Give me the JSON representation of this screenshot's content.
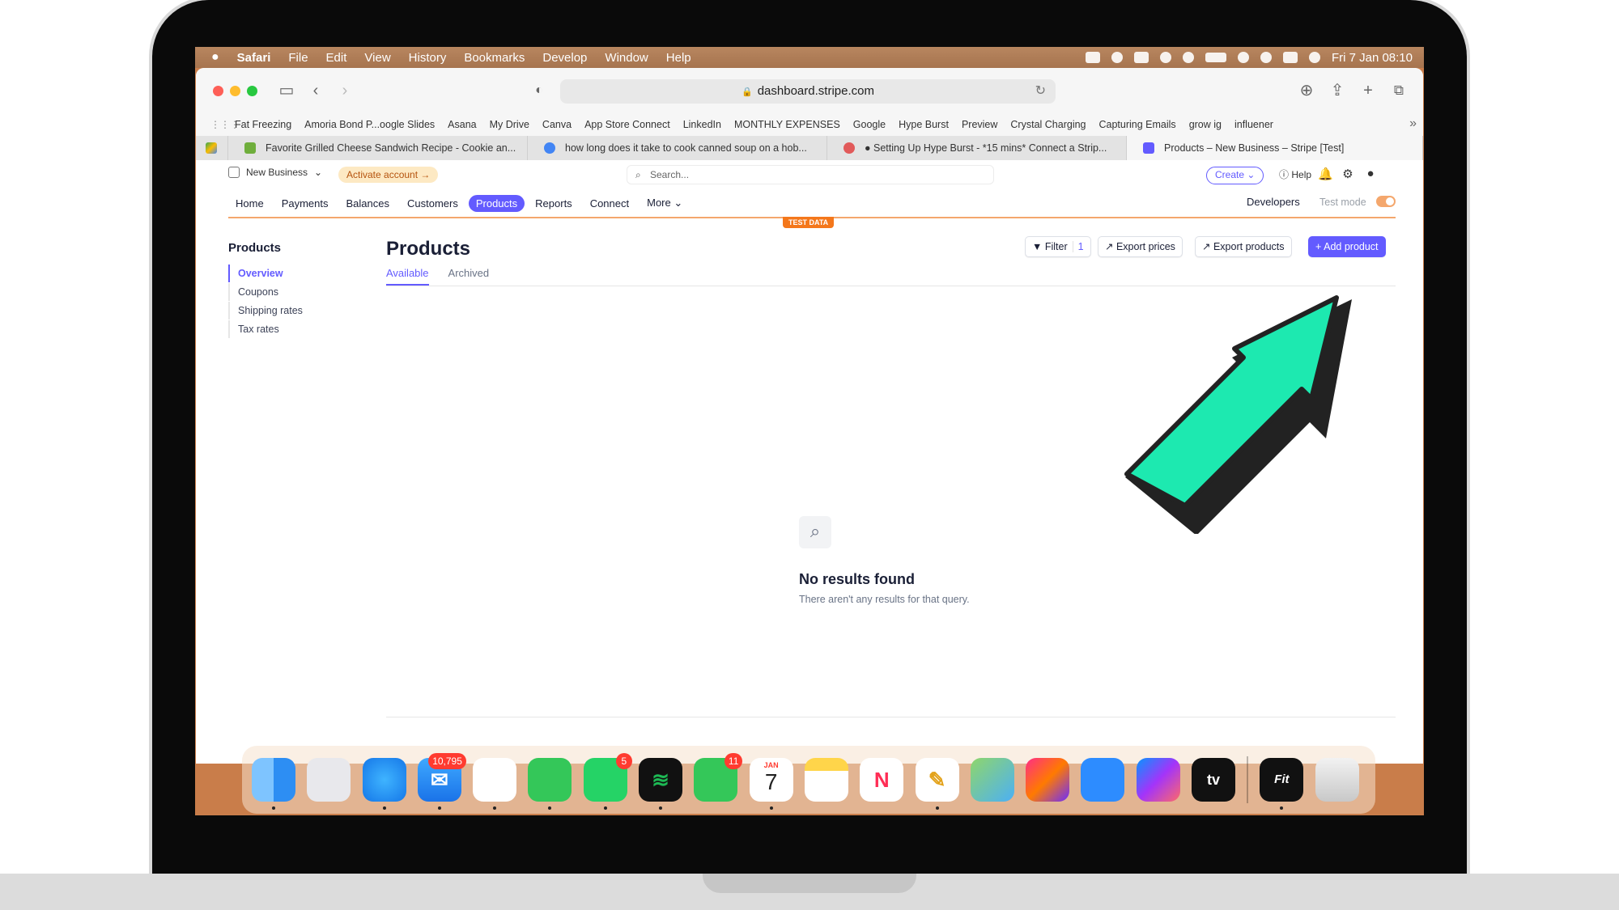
{
  "menubar": {
    "app": "Safari",
    "items": [
      "File",
      "Edit",
      "View",
      "History",
      "Bookmarks",
      "Develop",
      "Window",
      "Help"
    ],
    "clock": "Fri 7 Jan  08:10"
  },
  "browser": {
    "url": "dashboard.stripe.com",
    "bookmarks": [
      "Fat Freezing",
      "Amoria Bond P...oogle Slides",
      "Asana",
      "My Drive",
      "Canva",
      "App Store Connect",
      "LinkedIn",
      "MONTHLY EXPENSES",
      "Google",
      "Hype Burst",
      "Preview",
      "Crystal Charging",
      "Capturing Emails",
      "grow ig",
      "influener"
    ],
    "tabs": [
      {
        "title": "Favorite Grilled Cheese Sandwich Recipe - Cookie an...",
        "color": "#6fae3c"
      },
      {
        "title": "how long does it take to cook canned soup on a hob...",
        "color": "#4285f4"
      },
      {
        "title": "● Setting Up Hype Burst - *15 mins* Connect a Strip...",
        "color": "#e15a5a"
      },
      {
        "title": "Products – New Business – Stripe [Test]",
        "color": "#635bff"
      }
    ]
  },
  "stripe": {
    "business": "New Business",
    "activate": "Activate account",
    "search_placeholder": "Search...",
    "create": "Create",
    "help": "Help",
    "nav": [
      "Home",
      "Payments",
      "Balances",
      "Customers",
      "Products",
      "Reports",
      "Connect",
      "More"
    ],
    "developers": "Developers",
    "test_mode": "Test mode",
    "test_data": "TEST DATA",
    "sidebar_title": "Products",
    "sidebar": [
      "Overview",
      "Coupons",
      "Shipping rates",
      "Tax rates"
    ],
    "page_title": "Products",
    "subtabs": [
      "Available",
      "Archived"
    ],
    "filter": "Filter",
    "filter_count": "1",
    "export_prices": "Export prices",
    "export_products": "Export products",
    "add_product": "Add product",
    "empty_title": "No results found",
    "empty_sub": "There aren't any results for that query."
  },
  "dock": {
    "mail_badge": "10,795",
    "whatsapp_badge": "5",
    "facetime_badge": "11",
    "calendar_month": "JAN",
    "calendar_day": "7",
    "tv_label": "tv",
    "fit_label": "Fit"
  },
  "colors": {
    "stripe_accent": "#635bff",
    "arrow_fill": "#1de9b0",
    "arrow_stroke": "#222222"
  }
}
